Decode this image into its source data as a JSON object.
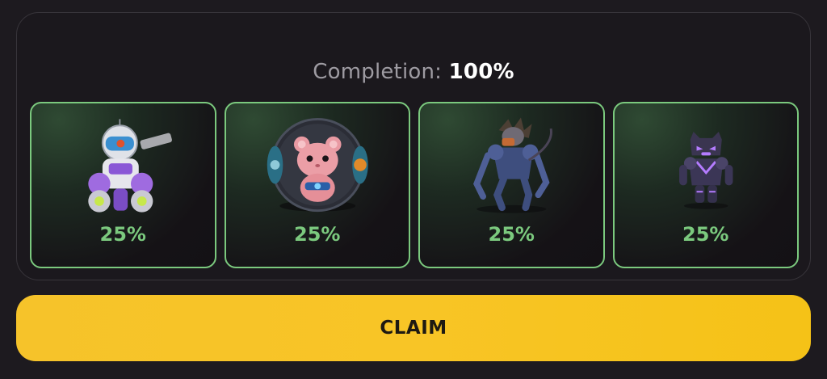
{
  "completion": {
    "label": "Completion:",
    "value": "100%"
  },
  "cards": [
    {
      "character": "robot-mech-icon",
      "percent": "25%"
    },
    {
      "character": "hamster-ball-icon",
      "percent": "25%"
    },
    {
      "character": "monster-creature-icon",
      "percent": "25%"
    },
    {
      "character": "panther-hero-icon",
      "percent": "25%"
    }
  ],
  "claim_button": {
    "label": "CLAIM"
  },
  "colors": {
    "accent_green": "#7bc97e",
    "claim_yellow": "#f8c526",
    "background": "#1d1a1f"
  }
}
